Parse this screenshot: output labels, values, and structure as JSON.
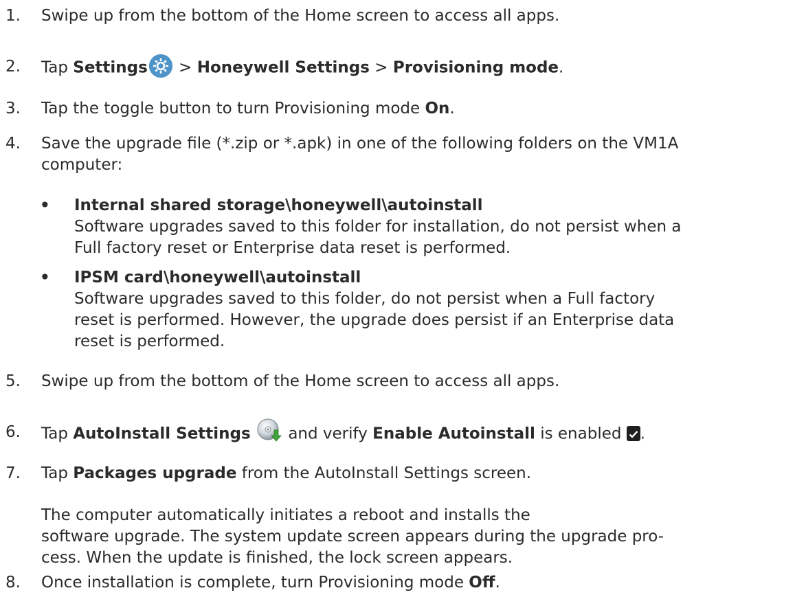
{
  "steps": [
    {
      "num": "1.",
      "text": "Swipe up from the bottom of the Home screen to access all apps."
    },
    {
      "num": "2.",
      "pre": "Tap ",
      "settings": "Settings",
      "sep1": " > ",
      "honeywell": "Honeywell Settings",
      "sep2": " > ",
      "provisioning": "Provisioning mode",
      "end": "."
    },
    {
      "num": "3.",
      "pre": "Tap the toggle button to turn Provisioning mode ",
      "on": "On",
      "end": "."
    },
    {
      "num": "4.",
      "line1": "Save the upgrade file (*.zip or *.apk) in one of the following folders on the VM1A",
      "line2": "computer:"
    },
    {
      "num": "5.",
      "text": "Swipe up from the bottom of the Home screen to access all apps."
    },
    {
      "num": "6.",
      "pre": "Tap ",
      "autoinstall": "AutoInstall Settings",
      "mid": " and verify ",
      "enable": "Enable Autoinstall",
      "post": " is enabled ",
      "end": "."
    },
    {
      "num": "7.",
      "pre": "Tap ",
      "packages": "Packages upgrade",
      "post": " from the AutoInstall Settings screen."
    },
    {
      "num": "8.",
      "pre": "Once installation is complete, turn Provisioning mode ",
      "off": "Off",
      "end": "."
    }
  ],
  "bullets": [
    {
      "marker": "•",
      "title": "Internal shared storage\\honeywell\\autoinstall",
      "line1": "Software upgrades saved to this folder for installation, do not persist when a",
      "line2": "Full factory reset or Enterprise data reset is performed."
    },
    {
      "marker": "•",
      "title": "IPSM card\\honeywell\\autoinstall",
      "line1": "Software upgrades saved to this folder, do not persist when a Full factory",
      "line2": "reset is performed. However, the upgrade does persist if an Enterprise data",
      "line3": "reset is performed."
    }
  ],
  "note": {
    "line1": "The computer automatically initiates a reboot and installs the",
    "line2": "software upgrade. The system update screen appears during the upgrade pro-",
    "line3": "cess. When the update is finished, the lock screen appears."
  },
  "icons": {
    "settings": "gear-icon",
    "autoinstall": "autoinstall-disc-icon",
    "checkbox": "checked-checkbox-icon"
  },
  "colors": {
    "text": "#2b2b2b",
    "settings_icon": "#4e94c8"
  }
}
